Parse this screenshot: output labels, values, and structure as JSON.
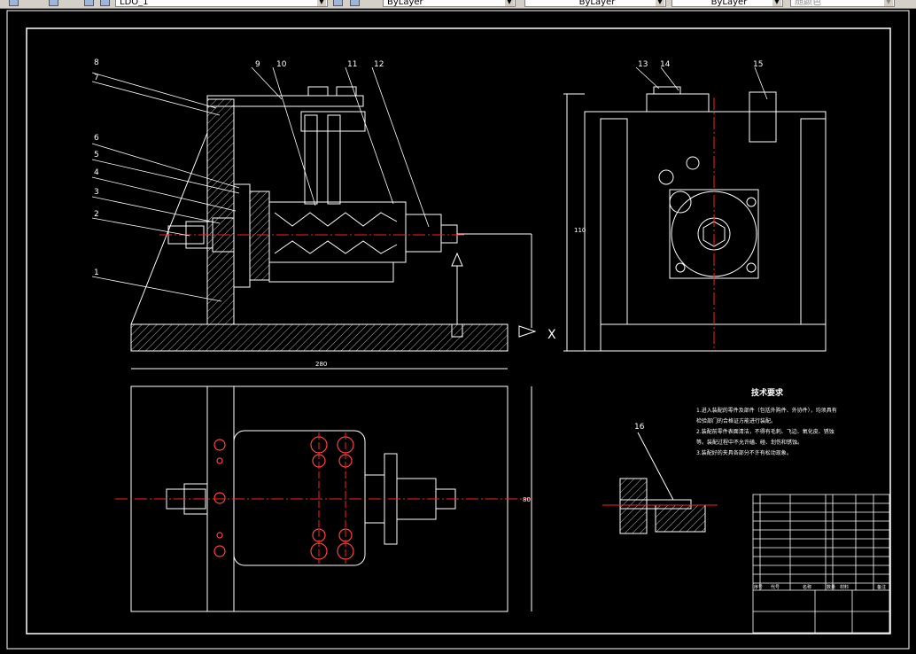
{
  "toolbar": {
    "layer_name": "LDO_1",
    "color_control": "ByLayer",
    "linetype_control": "ByLayer",
    "lineweight_control": "ByLayer",
    "plotstyle_control": "随颜色"
  },
  "colors": {
    "background": "#000000",
    "outline": "#ffffff",
    "centerline": "#ff2020",
    "hole": "#ff4040"
  },
  "balloons": {
    "front": [
      "8",
      "7",
      "6",
      "5",
      "4",
      "3",
      "2",
      "1"
    ],
    "front_top": [
      "9",
      "10",
      "11",
      "12"
    ],
    "side_top": [
      "13",
      "14",
      "15"
    ],
    "detail": "16"
  },
  "dimensions": {
    "plan_width": "280",
    "plan_height": "80",
    "side_height": "110",
    "section_marker": "X"
  },
  "tech_requirements": {
    "title": "技术要求",
    "lines": [
      "1.进入装配的零件及部件（包括外购件、外协件），均须具有",
      "检验部门的合格证方能进行装配。",
      "2.装配前零件表面清洁，不得有毛刺、飞边、氧化皮、锈蚀",
      "等。装配过程中不允许磕、碰、划伤和锈蚀。",
      "3.装配好的夹具各部分不许有松动现象。"
    ]
  },
  "title_block": {
    "header_labels": [
      "序号",
      "代号",
      "名称",
      "数量",
      "材料",
      "备注"
    ]
  }
}
